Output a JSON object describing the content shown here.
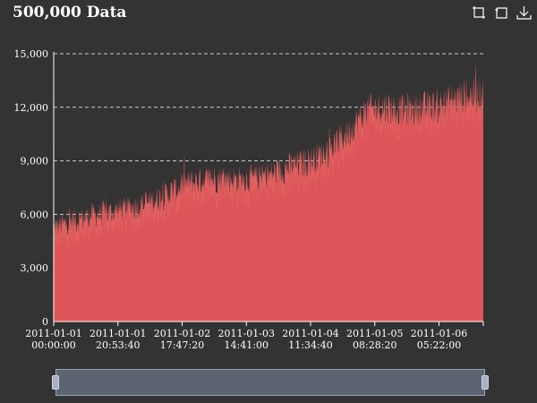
{
  "title": "500,000 Data",
  "toolbox": {
    "icons": [
      "zoom-icon",
      "restore-icon",
      "download-icon"
    ]
  },
  "colors": {
    "background": "#333333",
    "series": "#dd5558",
    "series_top": "#e36a67",
    "axis": "#ffffff",
    "grid": "#cccccc",
    "datazoom_fill": "#5d6370",
    "datazoom_border": "#9aa3b8"
  },
  "chart_data": {
    "type": "area",
    "title": "500,000 Data",
    "xlabel": "",
    "ylabel": "",
    "ylim": [
      0,
      15000
    ],
    "yticks": [
      "0",
      "3,000",
      "6,000",
      "9,000",
      "12,000",
      "15,000"
    ],
    "xticks": [
      [
        "2011-01-01",
        "00:00:00"
      ],
      [
        "2011-01-01",
        "20:53:40"
      ],
      [
        "2011-01-02",
        "17:47:20"
      ],
      [
        "2011-01-03",
        "14:41:00"
      ],
      [
        "2011-01-04",
        "11:34:40"
      ],
      [
        "2011-01-05",
        "08:28:20"
      ],
      [
        "2011-01-06",
        "05:22:00"
      ]
    ],
    "xrange": [
      "2011-01-01 00:00:00",
      "2011-01-06 19:46:40"
    ],
    "grid": "horizontal dashed",
    "trend": [
      {
        "x": "2011-01-01 00:00:00",
        "y": 5200
      },
      {
        "x": "2011-01-01 06:00:00",
        "y": 5600
      },
      {
        "x": "2011-01-01 12:00:00",
        "y": 5900
      },
      {
        "x": "2011-01-01 18:00:00",
        "y": 6100
      },
      {
        "x": "2011-01-02 00:00:00",
        "y": 6300
      },
      {
        "x": "2011-01-02 06:00:00",
        "y": 6600
      },
      {
        "x": "2011-01-02 12:00:00",
        "y": 7000
      },
      {
        "x": "2011-01-02 18:00:00",
        "y": 7600
      },
      {
        "x": "2011-01-03 00:00:00",
        "y": 7900
      },
      {
        "x": "2011-01-03 06:00:00",
        "y": 8000
      },
      {
        "x": "2011-01-03 12:00:00",
        "y": 7900
      },
      {
        "x": "2011-01-03 18:00:00",
        "y": 8000
      },
      {
        "x": "2011-01-04 00:00:00",
        "y": 8300
      },
      {
        "x": "2011-01-04 06:00:00",
        "y": 8700
      },
      {
        "x": "2011-01-04 12:00:00",
        "y": 9000
      },
      {
        "x": "2011-01-04 18:00:00",
        "y": 9600
      },
      {
        "x": "2011-01-05 00:00:00",
        "y": 10600
      },
      {
        "x": "2011-01-05 06:00:00",
        "y": 11800
      },
      {
        "x": "2011-01-05 12:00:00",
        "y": 12000
      },
      {
        "x": "2011-01-05 18:00:00",
        "y": 11800
      },
      {
        "x": "2011-01-06 00:00:00",
        "y": 11900
      },
      {
        "x": "2011-01-06 06:00:00",
        "y": 12100
      },
      {
        "x": "2011-01-06 12:00:00",
        "y": 12500
      },
      {
        "x": "2011-01-06 19:46:40",
        "y": 12800
      }
    ],
    "total_points": 500000,
    "datazoom_range": [
      0,
      100
    ]
  }
}
